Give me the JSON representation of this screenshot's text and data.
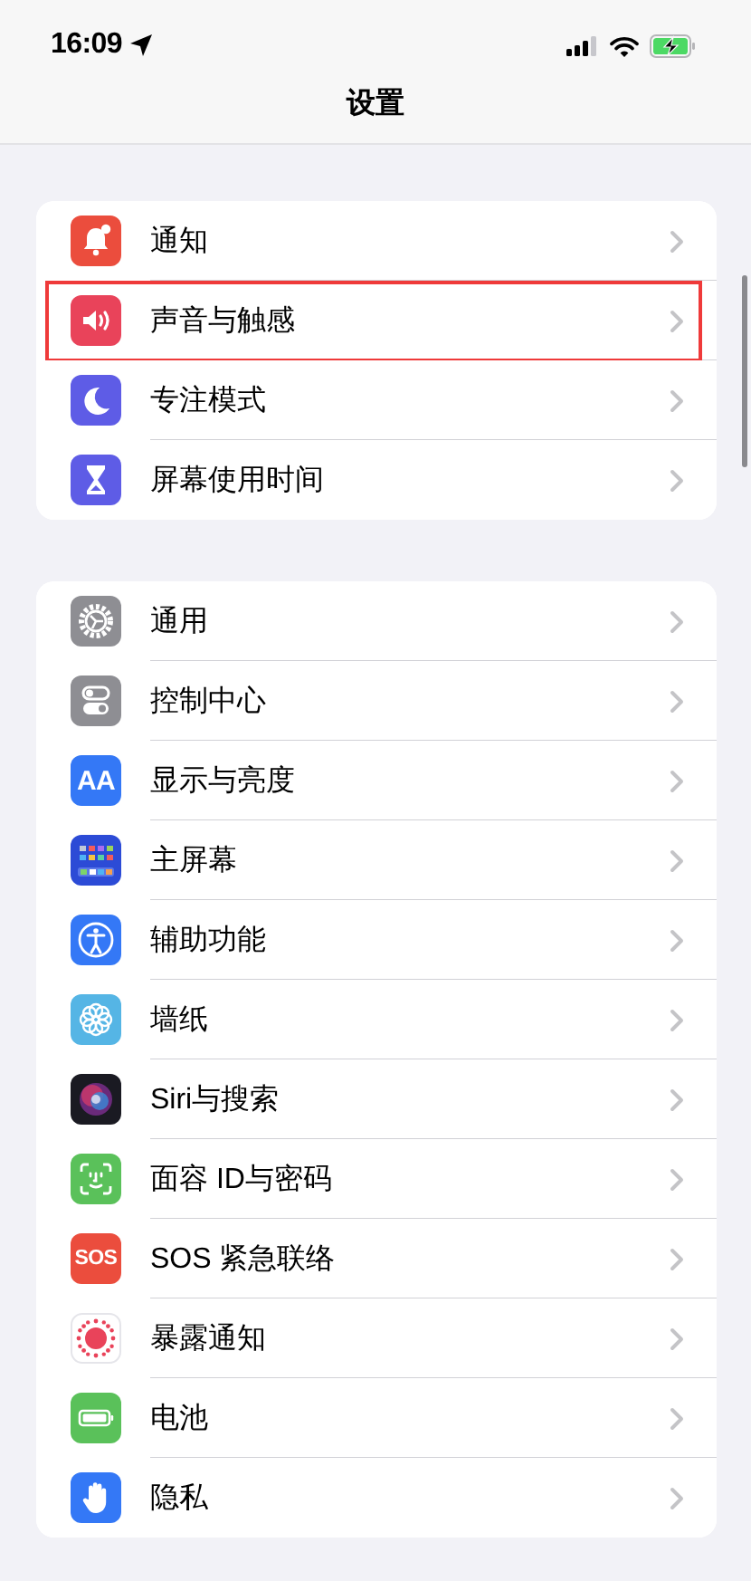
{
  "status_bar": {
    "time": "16:09"
  },
  "nav_bar": {
    "title": "设置"
  },
  "groups": [
    {
      "items": [
        {
          "kind": "bell",
          "label": "通知",
          "highlighted": false
        },
        {
          "kind": "speaker",
          "label": "声音与触感",
          "highlighted": true
        },
        {
          "kind": "moon",
          "label": "专注模式",
          "highlighted": false
        },
        {
          "kind": "hourglass",
          "label": "屏幕使用时间",
          "highlighted": false
        }
      ]
    },
    {
      "items": [
        {
          "kind": "gear",
          "label": "通用",
          "highlighted": false
        },
        {
          "kind": "toggles",
          "label": "控制中心",
          "highlighted": false
        },
        {
          "kind": "textsize",
          "label": "显示与亮度",
          "icon_text": "AA",
          "highlighted": false
        },
        {
          "kind": "grid",
          "label": "主屏幕",
          "highlighted": false
        },
        {
          "kind": "figure",
          "label": "辅助功能",
          "highlighted": false
        },
        {
          "kind": "flower",
          "label": "墙纸",
          "highlighted": false
        },
        {
          "kind": "orb",
          "label": "Siri与搜索",
          "highlighted": false
        },
        {
          "kind": "face",
          "label": "面容 ID与密码",
          "highlighted": false
        },
        {
          "kind": "sos",
          "label": "SOS 紧急联络",
          "icon_text": "SOS",
          "highlighted": false
        },
        {
          "kind": "sun",
          "label": "暴露通知",
          "highlighted": false
        },
        {
          "kind": "battery",
          "label": "电池",
          "highlighted": false
        },
        {
          "kind": "hand",
          "label": "隐私",
          "highlighted": false
        }
      ]
    }
  ]
}
